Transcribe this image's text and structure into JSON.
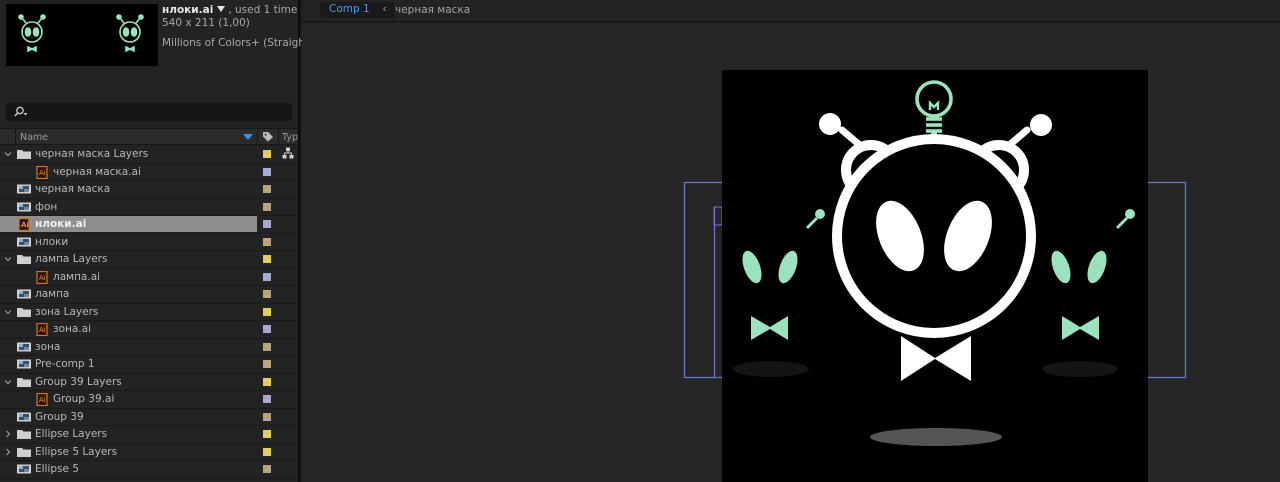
{
  "preview": {
    "filename": "нлоки.ai",
    "usage": ", used 1 time",
    "dimensions": "540 x 211 (1,00)",
    "color_mode": "Millions of Colors+ (Straight)"
  },
  "search": {
    "placeholder": ""
  },
  "columns": {
    "name": "Name",
    "type": "Typ"
  },
  "items": [
    {
      "label": "черная маска Layers",
      "kind": "folder",
      "indent": 0,
      "expanded": true,
      "swatch": "#e1cf56",
      "selected": false,
      "flow": true
    },
    {
      "label": "черная маска.ai",
      "kind": "ai",
      "indent": 1,
      "expanded": false,
      "swatch": "#a6a8d5",
      "selected": false,
      "flow": false
    },
    {
      "label": "черная маска",
      "kind": "comp",
      "indent": 0,
      "expanded": false,
      "swatch": "#b9a67a",
      "selected": false,
      "flow": false
    },
    {
      "label": "фон",
      "kind": "comp",
      "indent": 0,
      "expanded": false,
      "swatch": "#b9a67a",
      "selected": false,
      "flow": false
    },
    {
      "label": "нлоки.ai",
      "kind": "ai",
      "indent": 0,
      "expanded": false,
      "swatch": "#a6a8d5",
      "selected": true,
      "flow": false
    },
    {
      "label": "нлоки",
      "kind": "comp",
      "indent": 0,
      "expanded": false,
      "swatch": "#b9a67a",
      "selected": false,
      "flow": false
    },
    {
      "label": "лампа Layers",
      "kind": "folder",
      "indent": 0,
      "expanded": true,
      "swatch": "#e1cf56",
      "selected": false,
      "flow": false
    },
    {
      "label": "лампа.ai",
      "kind": "ai",
      "indent": 1,
      "expanded": false,
      "swatch": "#a6a8d5",
      "selected": false,
      "flow": false
    },
    {
      "label": "лампа",
      "kind": "comp",
      "indent": 0,
      "expanded": false,
      "swatch": "#b9a67a",
      "selected": false,
      "flow": false
    },
    {
      "label": "зона Layers",
      "kind": "folder",
      "indent": 0,
      "expanded": true,
      "swatch": "#e1cf56",
      "selected": false,
      "flow": false
    },
    {
      "label": "зона.ai",
      "kind": "ai",
      "indent": 1,
      "expanded": false,
      "swatch": "#a6a8d5",
      "selected": false,
      "flow": false
    },
    {
      "label": "зона",
      "kind": "comp",
      "indent": 0,
      "expanded": false,
      "swatch": "#b9a67a",
      "selected": false,
      "flow": false
    },
    {
      "label": "Pre-comp 1",
      "kind": "comp",
      "indent": 0,
      "expanded": false,
      "swatch": "#b9a67a",
      "selected": false,
      "flow": false
    },
    {
      "label": "Group 39 Layers",
      "kind": "folder",
      "indent": 0,
      "expanded": true,
      "swatch": "#e1cf56",
      "selected": false,
      "flow": false
    },
    {
      "label": "Group 39.ai",
      "kind": "ai",
      "indent": 1,
      "expanded": false,
      "swatch": "#a6a8d5",
      "selected": false,
      "flow": false
    },
    {
      "label": "Group 39",
      "kind": "comp",
      "indent": 0,
      "expanded": false,
      "swatch": "#b9a67a",
      "selected": false,
      "flow": false
    },
    {
      "label": "Ellipse Layers",
      "kind": "folder",
      "indent": 0,
      "expanded": false,
      "swatch": "#e1cf56",
      "selected": false,
      "flow": false
    },
    {
      "label": "Ellipse 5 Layers",
      "kind": "folder",
      "indent": 0,
      "expanded": false,
      "swatch": "#e1cf56",
      "selected": false,
      "flow": false
    },
    {
      "label": "Ellipse 5",
      "kind": "comp",
      "indent": 0,
      "expanded": false,
      "swatch": "#b9a67a",
      "selected": false,
      "flow": false
    }
  ],
  "viewer": {
    "tab_label": "Comp 1",
    "breadcrumb": "черная маска"
  },
  "colors": {
    "accent": "#4a9ae8",
    "mint": "#9be3bc",
    "selection": "#8e8e8e",
    "guide": "#6e76c6"
  }
}
